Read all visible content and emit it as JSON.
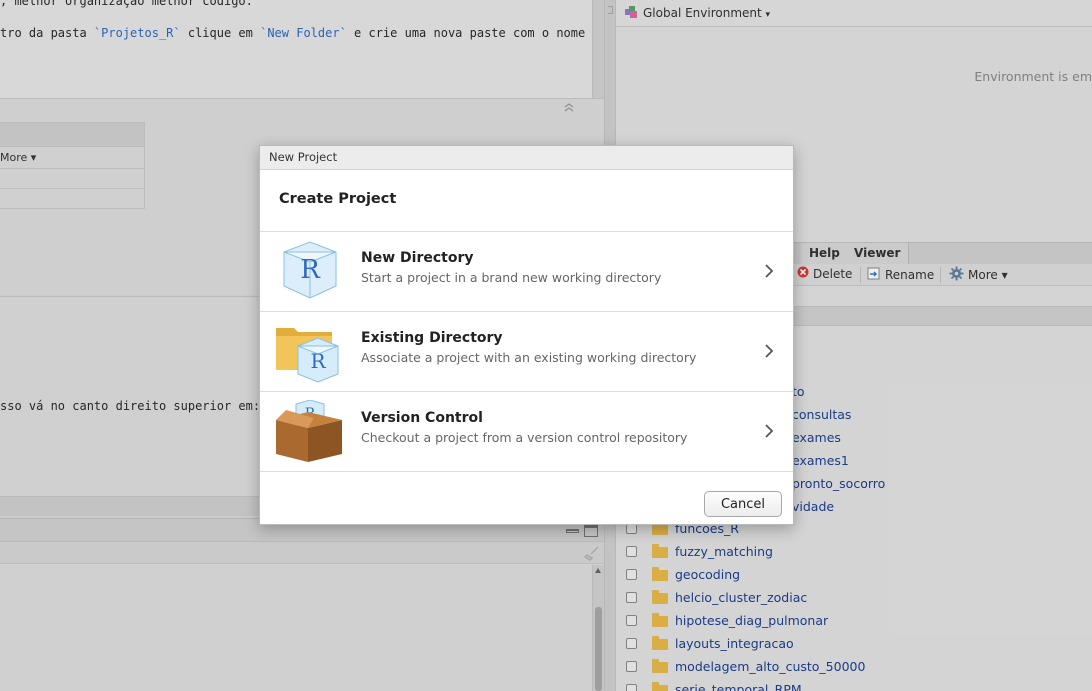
{
  "editor": {
    "line1": "; melhor organização melhor código.",
    "line2_pre": "tro da pasta ",
    "line2_code1": "`Projetos_R`",
    "line2_mid": " clique em ",
    "line2_code2": "`New Folder`",
    "line2_post": " e crie uma nova paste com o nome do"
  },
  "inner_toolbar": {
    "more_label": "More ▾"
  },
  "console": {
    "text": "sso vá no canto direito superior em:"
  },
  "environment": {
    "title": "Global Environment",
    "dropdown_glyph": "▾",
    "empty_text": "Environment is em"
  },
  "files_pane": {
    "tabs": [
      {
        "label": "Help"
      },
      {
        "label": "Viewer"
      }
    ],
    "toolbar": {
      "delete_label": "Delete",
      "rename_label": "Rename",
      "more_label": "More ▾"
    },
    "partial_items": [
      "to",
      "consultas",
      "exames",
      "exames1",
      "pronto_socorro",
      "vidade"
    ],
    "items": [
      "funcoes_R",
      "fuzzy_matching",
      "geocoding",
      "helcio_cluster_zodiac",
      "hipotese_diag_pulmonar",
      "layouts_integracao",
      "modelagem_alto_custo_50000",
      "serie_temporal_RPM"
    ]
  },
  "dialog": {
    "window_title": "New Project",
    "heading": "Create Project",
    "options": [
      {
        "title": "New Directory",
        "subtitle": "Start a project in a brand new working directory"
      },
      {
        "title": "Existing Directory",
        "subtitle": "Associate a project with an existing working directory"
      },
      {
        "title": "Version Control",
        "subtitle": "Checkout a project from a version control repository"
      }
    ],
    "cancel_label": "Cancel"
  },
  "colors": {
    "link": "#1d3f8f",
    "folder": "#e7b94a",
    "accent_blue": "#2f6abf"
  }
}
